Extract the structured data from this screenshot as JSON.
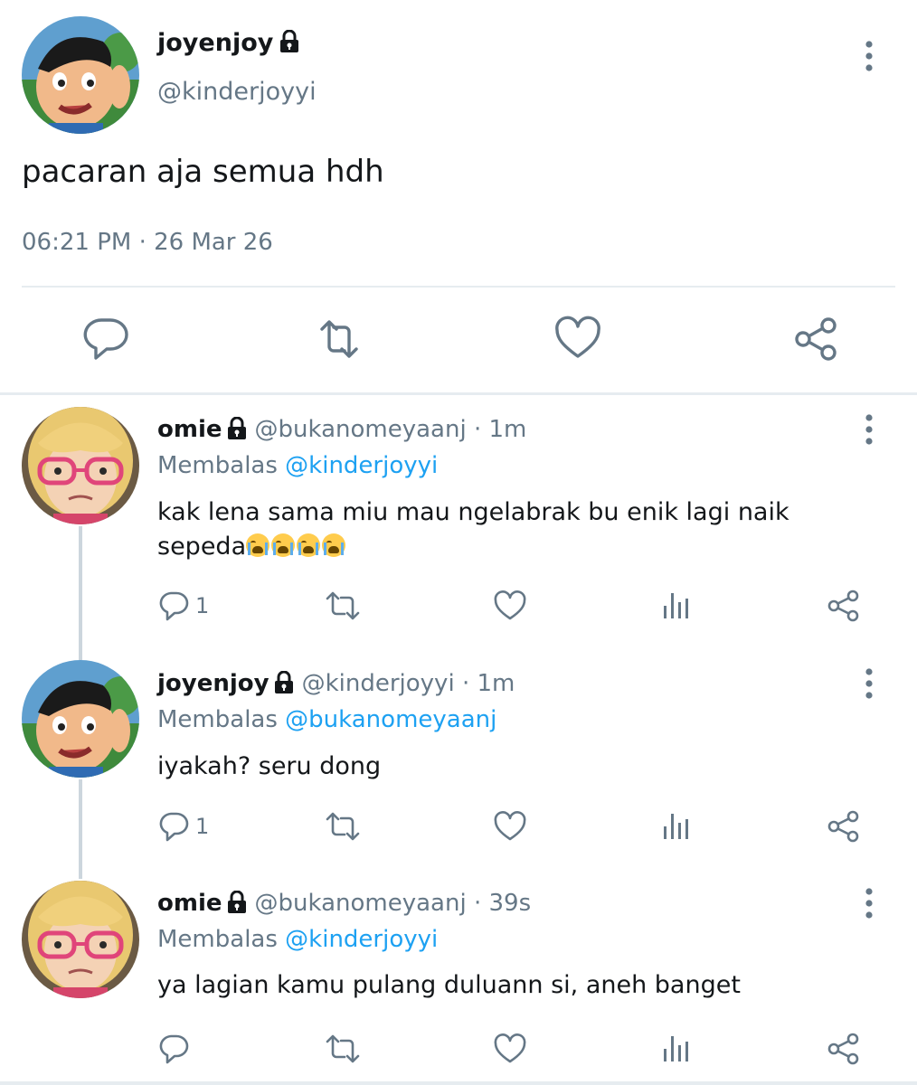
{
  "main_tweet": {
    "display_name": "joyenjoy",
    "handle": "@kinderjoyyi",
    "text": "pacaran aja semua hdh",
    "timestamp": "06:21 PM · 26 Mar 26",
    "protected_icon": "lock-icon",
    "actions": [
      "reply-icon",
      "retweet-icon",
      "like-icon",
      "share-icon"
    ]
  },
  "replies": [
    {
      "display_name": "omie",
      "handle": "@bukanomeyaanj",
      "time": "· 1m",
      "replying_label": "Membalas",
      "replying_to": "@kinderjoyyi",
      "text": "kak lena sama miu mau ngelabrak bu enik lagi naik sepeda",
      "emoji": "😭😭😭😭",
      "reply_count": "1"
    },
    {
      "display_name": "joyenjoy",
      "handle": "@kinderjoyyi",
      "time": "· 1m",
      "replying_label": "Membalas",
      "replying_to": "@bukanomeyaanj",
      "text": "iyakah? seru dong",
      "reply_count": "1"
    },
    {
      "display_name": "omie",
      "handle": "@bukanomeyaanj",
      "time": "· 39s",
      "replying_label": "Membalas",
      "replying_to": "@kinderjoyyi",
      "text": "ya lagian kamu pulang duluann si, aneh banget",
      "reply_count": ""
    }
  ],
  "colors": {
    "text": "#14171a",
    "secondary": "#657786",
    "link": "#1da1f2",
    "divider": "#e6ecf0",
    "thread_line": "#ccd6dd"
  }
}
